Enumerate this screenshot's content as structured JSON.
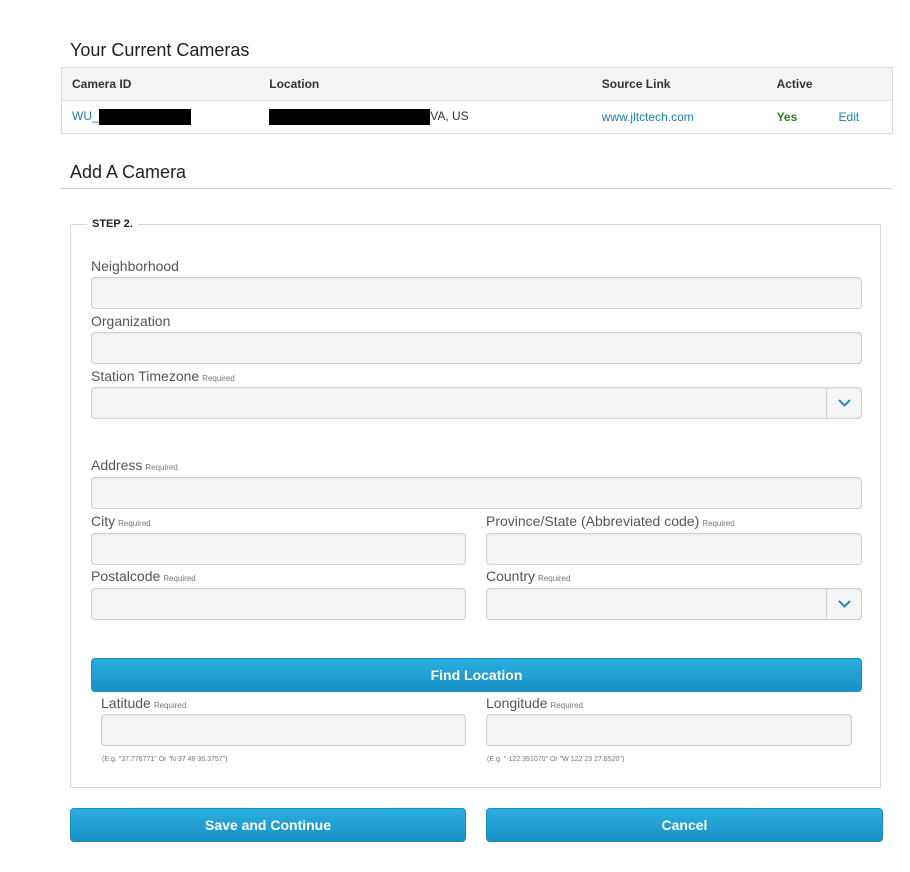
{
  "current": {
    "title": "Your Current Cameras",
    "headers": {
      "camera_id": "Camera ID",
      "location": "Location",
      "source_link": "Source Link",
      "active": "Active"
    },
    "row": {
      "camera_id_prefix": "WU_",
      "location_suffix": "VA, US",
      "source_link": "www.jltctech.com",
      "active": "Yes",
      "edit": "Edit"
    }
  },
  "add": {
    "title": "Add A Camera",
    "step": "STEP 2.",
    "required_tag": "Required",
    "fields": {
      "neighborhood": "Neighborhood",
      "organization": "Organization",
      "timezone": "Station Timezone",
      "address": "Address",
      "city": "City",
      "state": "Province/State (Abbreviated code)",
      "postalcode": "Postalcode",
      "country": "Country",
      "latitude": "Latitude",
      "longitude": "Longitude"
    },
    "hints": {
      "latitude": "(E.g. \"37.776771\" Or \"N 37 46 36.3757\")",
      "longitude": "(E.g. \"-122.391070\" Or \"W 122 23 27.8520\")"
    },
    "find_button": "Find Location",
    "save_button": "Save and Continue",
    "cancel_button": "Cancel"
  },
  "colors": {
    "accent": "#1990c6",
    "link": "#1d7fb5",
    "active_green": "#2e7d1e"
  },
  "icons": {
    "select_arrow": "chevron-down-icon"
  }
}
